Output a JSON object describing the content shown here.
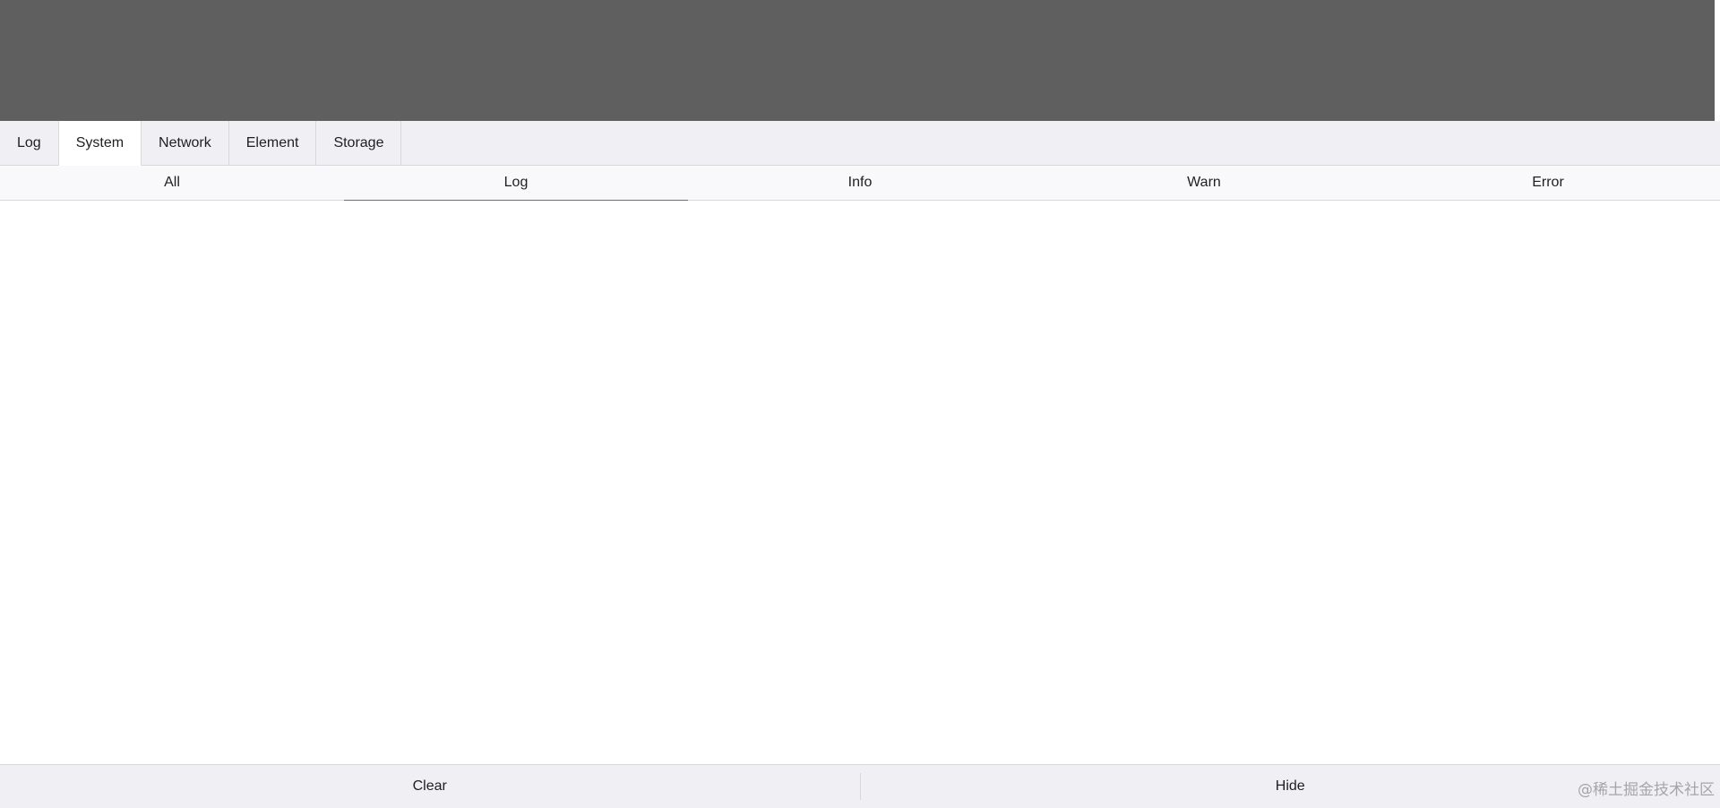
{
  "tabs": [
    {
      "label": "Log",
      "active": false
    },
    {
      "label": "System",
      "active": true
    },
    {
      "label": "Network",
      "active": false
    },
    {
      "label": "Element",
      "active": false
    },
    {
      "label": "Storage",
      "active": false
    }
  ],
  "filters": [
    {
      "label": "All",
      "active": false
    },
    {
      "label": "Log",
      "active": true
    },
    {
      "label": "Info",
      "active": false
    },
    {
      "label": "Warn",
      "active": false
    },
    {
      "label": "Error",
      "active": false
    }
  ],
  "footer": {
    "clear_label": "Clear",
    "hide_label": "Hide"
  },
  "watermark": "@稀土掘金技术社区",
  "colors": {
    "backdrop": "#5f5f5f",
    "tabbar_bg": "#efeff4",
    "subbar_bg": "#f9f9fb",
    "accent": "#1485ee"
  }
}
